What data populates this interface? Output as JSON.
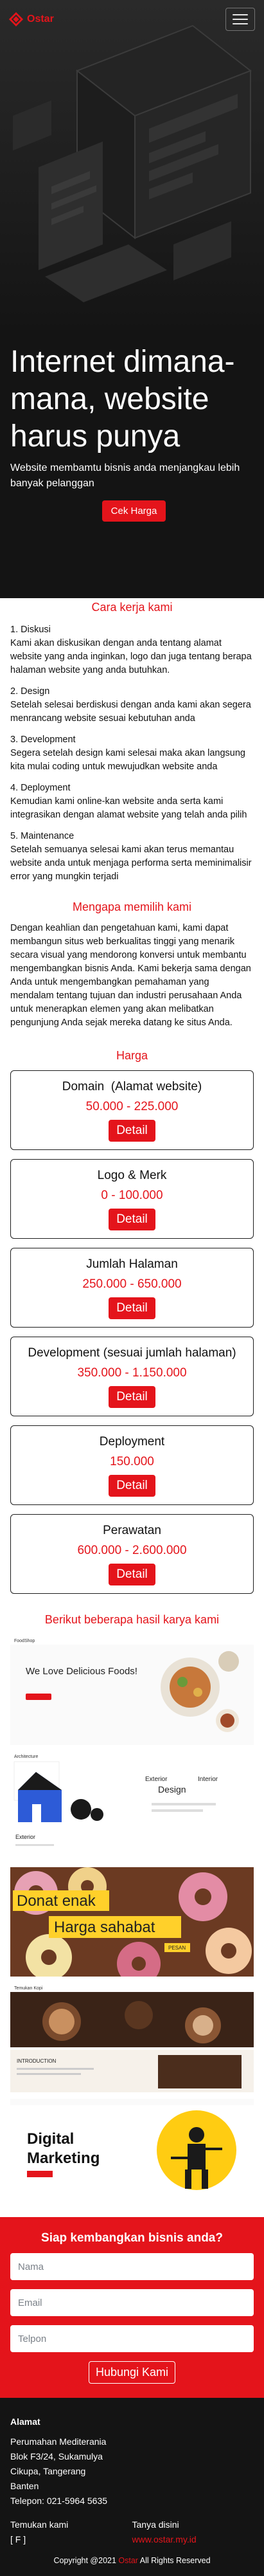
{
  "brand": {
    "name": "Ostar"
  },
  "colors": {
    "accent": "#e4141b",
    "dark": "#141414"
  },
  "hero": {
    "title": "Internet dimana-mana, website harus punya",
    "subtitle": "Website membamtu bisnis anda menjangkau lebih banyak pelanggan",
    "cta_label": "Cek Harga"
  },
  "process": {
    "title": "Cara kerja kami",
    "steps": [
      {
        "title": "1. Diskusi",
        "text": "Kami akan diskusikan dengan anda tentang alamat website yang anda inginkan, logo dan juga tentang berapa halaman website yang anda butuhkan."
      },
      {
        "title": "2. Design",
        "text": "Setelah selesai berdiskusi dengan anda kami akan segera menrancang website sesuai kebutuhan anda"
      },
      {
        "title": "3. Development",
        "text": "Segera setelah design kami selesai maka akan langsung kita mulai coding untuk mewujudkan website anda"
      },
      {
        "title": "4. Deployment",
        "text": "Kemudian kami online-kan website anda serta kami integrasikan dengan alamat website yang telah anda pilih"
      },
      {
        "title": "5. Maintenance",
        "text": "Setelah semuanya selesai kami akan terus memantau website anda untuk menjaga performa serta meminimalisir error yang mungkin terjadi"
      }
    ]
  },
  "why": {
    "title": "Mengapa memilih kami",
    "text": "Dengan keahlian dan pengetahuan kami, kami dapat membangun situs web berkualitas tinggi yang menarik secara visual yang mendorong konversi untuk membantu mengembangkan bisnis Anda. Kami bekerja sama dengan Anda untuk mengembangkan pemahaman yang mendalam tentang tujuan dan industri perusahaan Anda untuk menerapkan elemen yang akan melibatkan pengunjung Anda sejak mereka datang ke situs Anda."
  },
  "pricing": {
    "title": "Harga",
    "detail_label": "Detail",
    "items": [
      {
        "name": "Domain  (Alamat website)",
        "price": "50.000 - 225.000"
      },
      {
        "name": "Logo & Merk",
        "price": "0 - 100.000"
      },
      {
        "name": "Jumlah Halaman",
        "price": "250.000 - 650.000"
      },
      {
        "name": "Development (sesuai jumlah halaman)",
        "price": "350.000 - 1.150.000"
      },
      {
        "name": "Deployment",
        "price": "150.000"
      },
      {
        "name": "Perawatan",
        "price": "600.000 - 2.600.000"
      }
    ]
  },
  "portfolio": {
    "title": "Berikut beberapa hasil karya kami",
    "items": [
      {
        "headline": "We Love Delicious Foods!",
        "nav_brand": "FoodShop"
      },
      {
        "headline1": "Exterior",
        "headline2": "Interior",
        "headline3": "Design",
        "nav_brand": "Architecture",
        "bottom_label": "Exterior"
      },
      {
        "line1": "Donat enak",
        "line2": "Harga sahabat",
        "tag": "PESAN"
      },
      {
        "nav_brand": "Temukan Kopi",
        "bottom_label": "INTRODUCTION"
      },
      {
        "line1": "Digital",
        "line2": "Marketing"
      }
    ]
  },
  "contact": {
    "title": "Siap kembangkan bisnis anda?",
    "name_placeholder": "Nama",
    "email_placeholder": "Email",
    "phone_placeholder": "Telpon",
    "submit_label": "Hubungi Kami"
  },
  "footer": {
    "address_heading": "Alamat",
    "address_lines": [
      "Perumahan Mediterania",
      "Blok F3/24, Sukamulya",
      "Cikupa, Tangerang",
      "Banten"
    ],
    "phone": "Telepon: 021-5964 5635",
    "follow_label": "Temukan kami",
    "social": "[ F ]",
    "ask_label": "Tanya disini",
    "site": "www.ostar.my.id",
    "copyright_prefix": "Copyright @2021",
    "copyright_brand": "Ostar",
    "copyright_suffix": "All Rights Reserved"
  }
}
